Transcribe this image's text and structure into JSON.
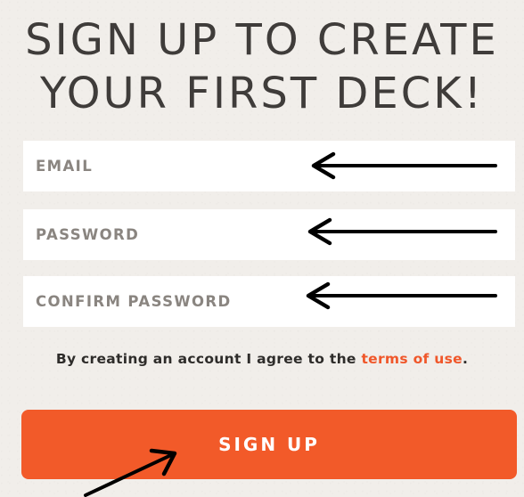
{
  "heading": {
    "line1": "SIGN UP TO CREATE",
    "line2": "YOUR FIRST DECK!"
  },
  "form": {
    "email_placeholder": "EMAIL",
    "password_placeholder": "PASSWORD",
    "confirm_password_placeholder": "CONFIRM PASSWORD"
  },
  "terms": {
    "prefix": "By creating an account I agree to the",
    "link_label": "terms of use",
    "suffix": "."
  },
  "signup_button": {
    "label": "SIGN UP"
  },
  "colors": {
    "background": "#f1eeea",
    "accent": "#f25a29",
    "heading": "#3f3c3a",
    "placeholder": "#8a8580"
  },
  "annotations": {
    "arrow_icon": "arrow-left-icon",
    "pointer_icon": "arrow-up-right-icon"
  }
}
